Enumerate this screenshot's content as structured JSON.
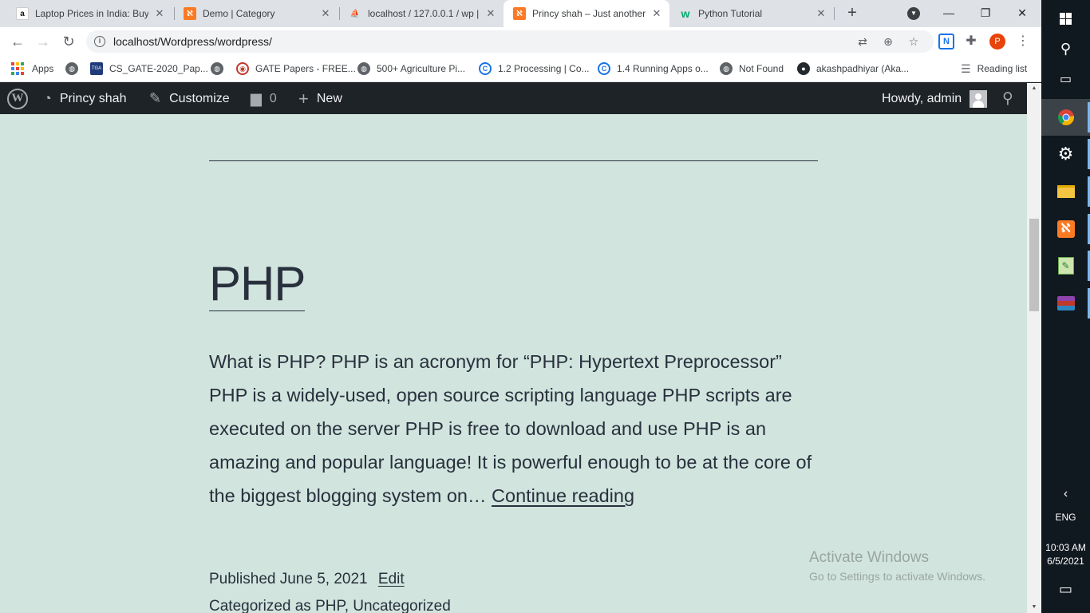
{
  "browser": {
    "tabs": [
      {
        "title": "Laptop Prices in India: Buy",
        "favicon": "amazon-icon"
      },
      {
        "title": "Demo | Category",
        "favicon": "xampp-icon"
      },
      {
        "title": "localhost / 127.0.0.1 / wp |",
        "favicon": "phpmyadmin-icon"
      },
      {
        "title": "Princy shah – Just another",
        "favicon": "xampp-icon",
        "active": true
      },
      {
        "title": "Python Tutorial",
        "favicon": "w3schools-icon"
      }
    ],
    "url": "localhost/Wordpress/wordpress/",
    "profile_initial": "P",
    "bookmarks": [
      {
        "label": "Apps",
        "icon": "apps-grid-icon"
      },
      {
        "label": "CS_GATE-2020_Pap...",
        "icon": "tga-icon"
      },
      {
        "label": "GATE Papers - FREE...",
        "icon": "iisc-icon"
      },
      {
        "label": "500+ Agriculture Pi...",
        "icon": "globe-icon"
      },
      {
        "label": "1.2 Processing | Co...",
        "icon": "c-icon"
      },
      {
        "label": "1.4 Running Apps o...",
        "icon": "c-icon"
      },
      {
        "label": "Not Found",
        "icon": "globe-icon"
      },
      {
        "label": "akashpadhiyar (Aka...",
        "icon": "github-icon"
      }
    ],
    "reading_list": "Reading list"
  },
  "adminbar": {
    "site_name": "Princy shah",
    "customize": "Customize",
    "comments_count": "0",
    "new_label": "New",
    "howdy": "Howdy, admin"
  },
  "post": {
    "title": "PHP",
    "excerpt": "What is PHP? PHP is an acronym for “PHP: Hypertext Preprocessor” PHP is a widely-used, open source scripting language PHP scripts are executed on the server PHP is free to download and use PHP is an amazing and popular language! It is powerful enough to be at the core of the biggest blogging system on…",
    "continue_reading": "Continue reading",
    "published_label": "Published",
    "date": "June 5, 2021",
    "edit_label": "Edit",
    "categorized_label": "Categorized as",
    "categories": [
      "PHP",
      "Uncategorized"
    ]
  },
  "watermark": {
    "line1": "Activate Windows",
    "line2": "Go to Settings to activate Windows."
  },
  "taskbar": {
    "language": "ENG",
    "time": "10:03 AM",
    "date": "6/5/2021"
  },
  "colors": {
    "page_bg": "#d1e4dd",
    "text": "#28303d",
    "adminbar_bg": "#1d2327"
  }
}
